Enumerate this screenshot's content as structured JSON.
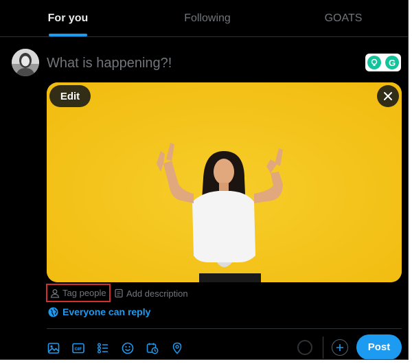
{
  "tabs": [
    {
      "label": "For you",
      "active": true
    },
    {
      "label": "Following",
      "active": false
    },
    {
      "label": "GOATS",
      "active": false
    }
  ],
  "composer": {
    "placeholder": "What is happening?!"
  },
  "grammarly": {
    "logo_letter": "G"
  },
  "media": {
    "edit_label": "Edit"
  },
  "media_actions": {
    "tag_people_label": "Tag people",
    "add_description_label": "Add description"
  },
  "reply_setting": {
    "label": "Everyone can reply"
  },
  "toolbar": {
    "icons": [
      "image-icon",
      "gif-icon",
      "poll-icon",
      "emoji-icon",
      "schedule-icon",
      "location-icon"
    ],
    "post_label": "Post"
  },
  "colors": {
    "accent": "#1d9bf0",
    "background": "#000000",
    "muted_text": "#71767b",
    "highlight_box": "#d0312d",
    "media_background": "#f5c41a"
  }
}
